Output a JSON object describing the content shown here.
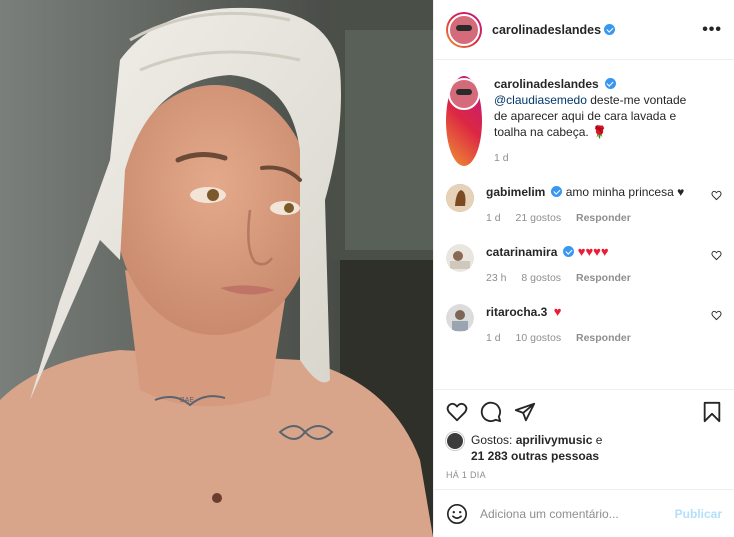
{
  "post": {
    "author": "carolinadeslandes",
    "more_label": "•••",
    "caption": {
      "username": "carolinadeslandes",
      "mention": "@claudiasemedo",
      "text": " deste-me vontade de aparecer aqui de cara lavada e toalha na cabeça. 🌹",
      "time": "1 d"
    },
    "comments": [
      {
        "username": "gabimelim",
        "verified": true,
        "text": "amo minha princesa ♥",
        "time": "1 d",
        "likes": "21 gostos",
        "reply": "Responder"
      },
      {
        "username": "catarinamira",
        "verified": true,
        "text": "♥♥♥♥",
        "time": "23 h",
        "likes": "8 gostos",
        "reply": "Responder"
      },
      {
        "username": "ritarocha.3",
        "verified": false,
        "text": "♥",
        "time": "1 d",
        "likes": "10 gostos",
        "reply": "Responder"
      }
    ],
    "likes": {
      "prefix": "Gostos: ",
      "user": "aprilivymusic",
      "middle": " e",
      "others": "21 283 outras pessoas"
    },
    "date": "HÁ 1 DIA",
    "add_comment": {
      "placeholder": "Adiciona um comentário...",
      "publish_label": "Publicar"
    }
  },
  "icons": [
    "heart-icon",
    "comment-icon",
    "share-icon",
    "bookmark-icon",
    "emoji-icon",
    "verified-icon",
    "more-icon"
  ],
  "colors": {
    "accent": "#3897f0",
    "muted": "#8e8e8e",
    "heart": "#ed1c35",
    "publish_disabled": "#b2dffc"
  }
}
